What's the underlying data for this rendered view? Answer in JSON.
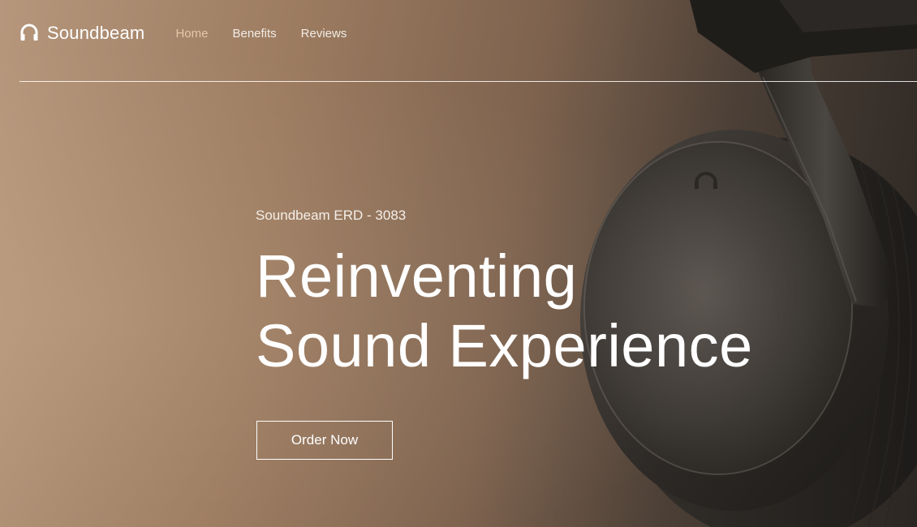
{
  "brand": {
    "name": "Soundbeam",
    "icon": "headphones-icon"
  },
  "nav": {
    "items": [
      {
        "label": "Home",
        "active": true
      },
      {
        "label": "Benefits",
        "active": false
      },
      {
        "label": "Reviews",
        "active": false
      }
    ]
  },
  "hero": {
    "model": "Soundbeam ERD - 3083",
    "headline_line1": "Reinventing",
    "headline_line2": "Sound Experience",
    "cta_label": "Order Now",
    "image": "headphones-photo"
  },
  "colors": {
    "accent_active_nav": "#e6c7a7",
    "background_warm": "#a3826a",
    "background_dark": "#2a2622",
    "text": "#ffffff"
  }
}
